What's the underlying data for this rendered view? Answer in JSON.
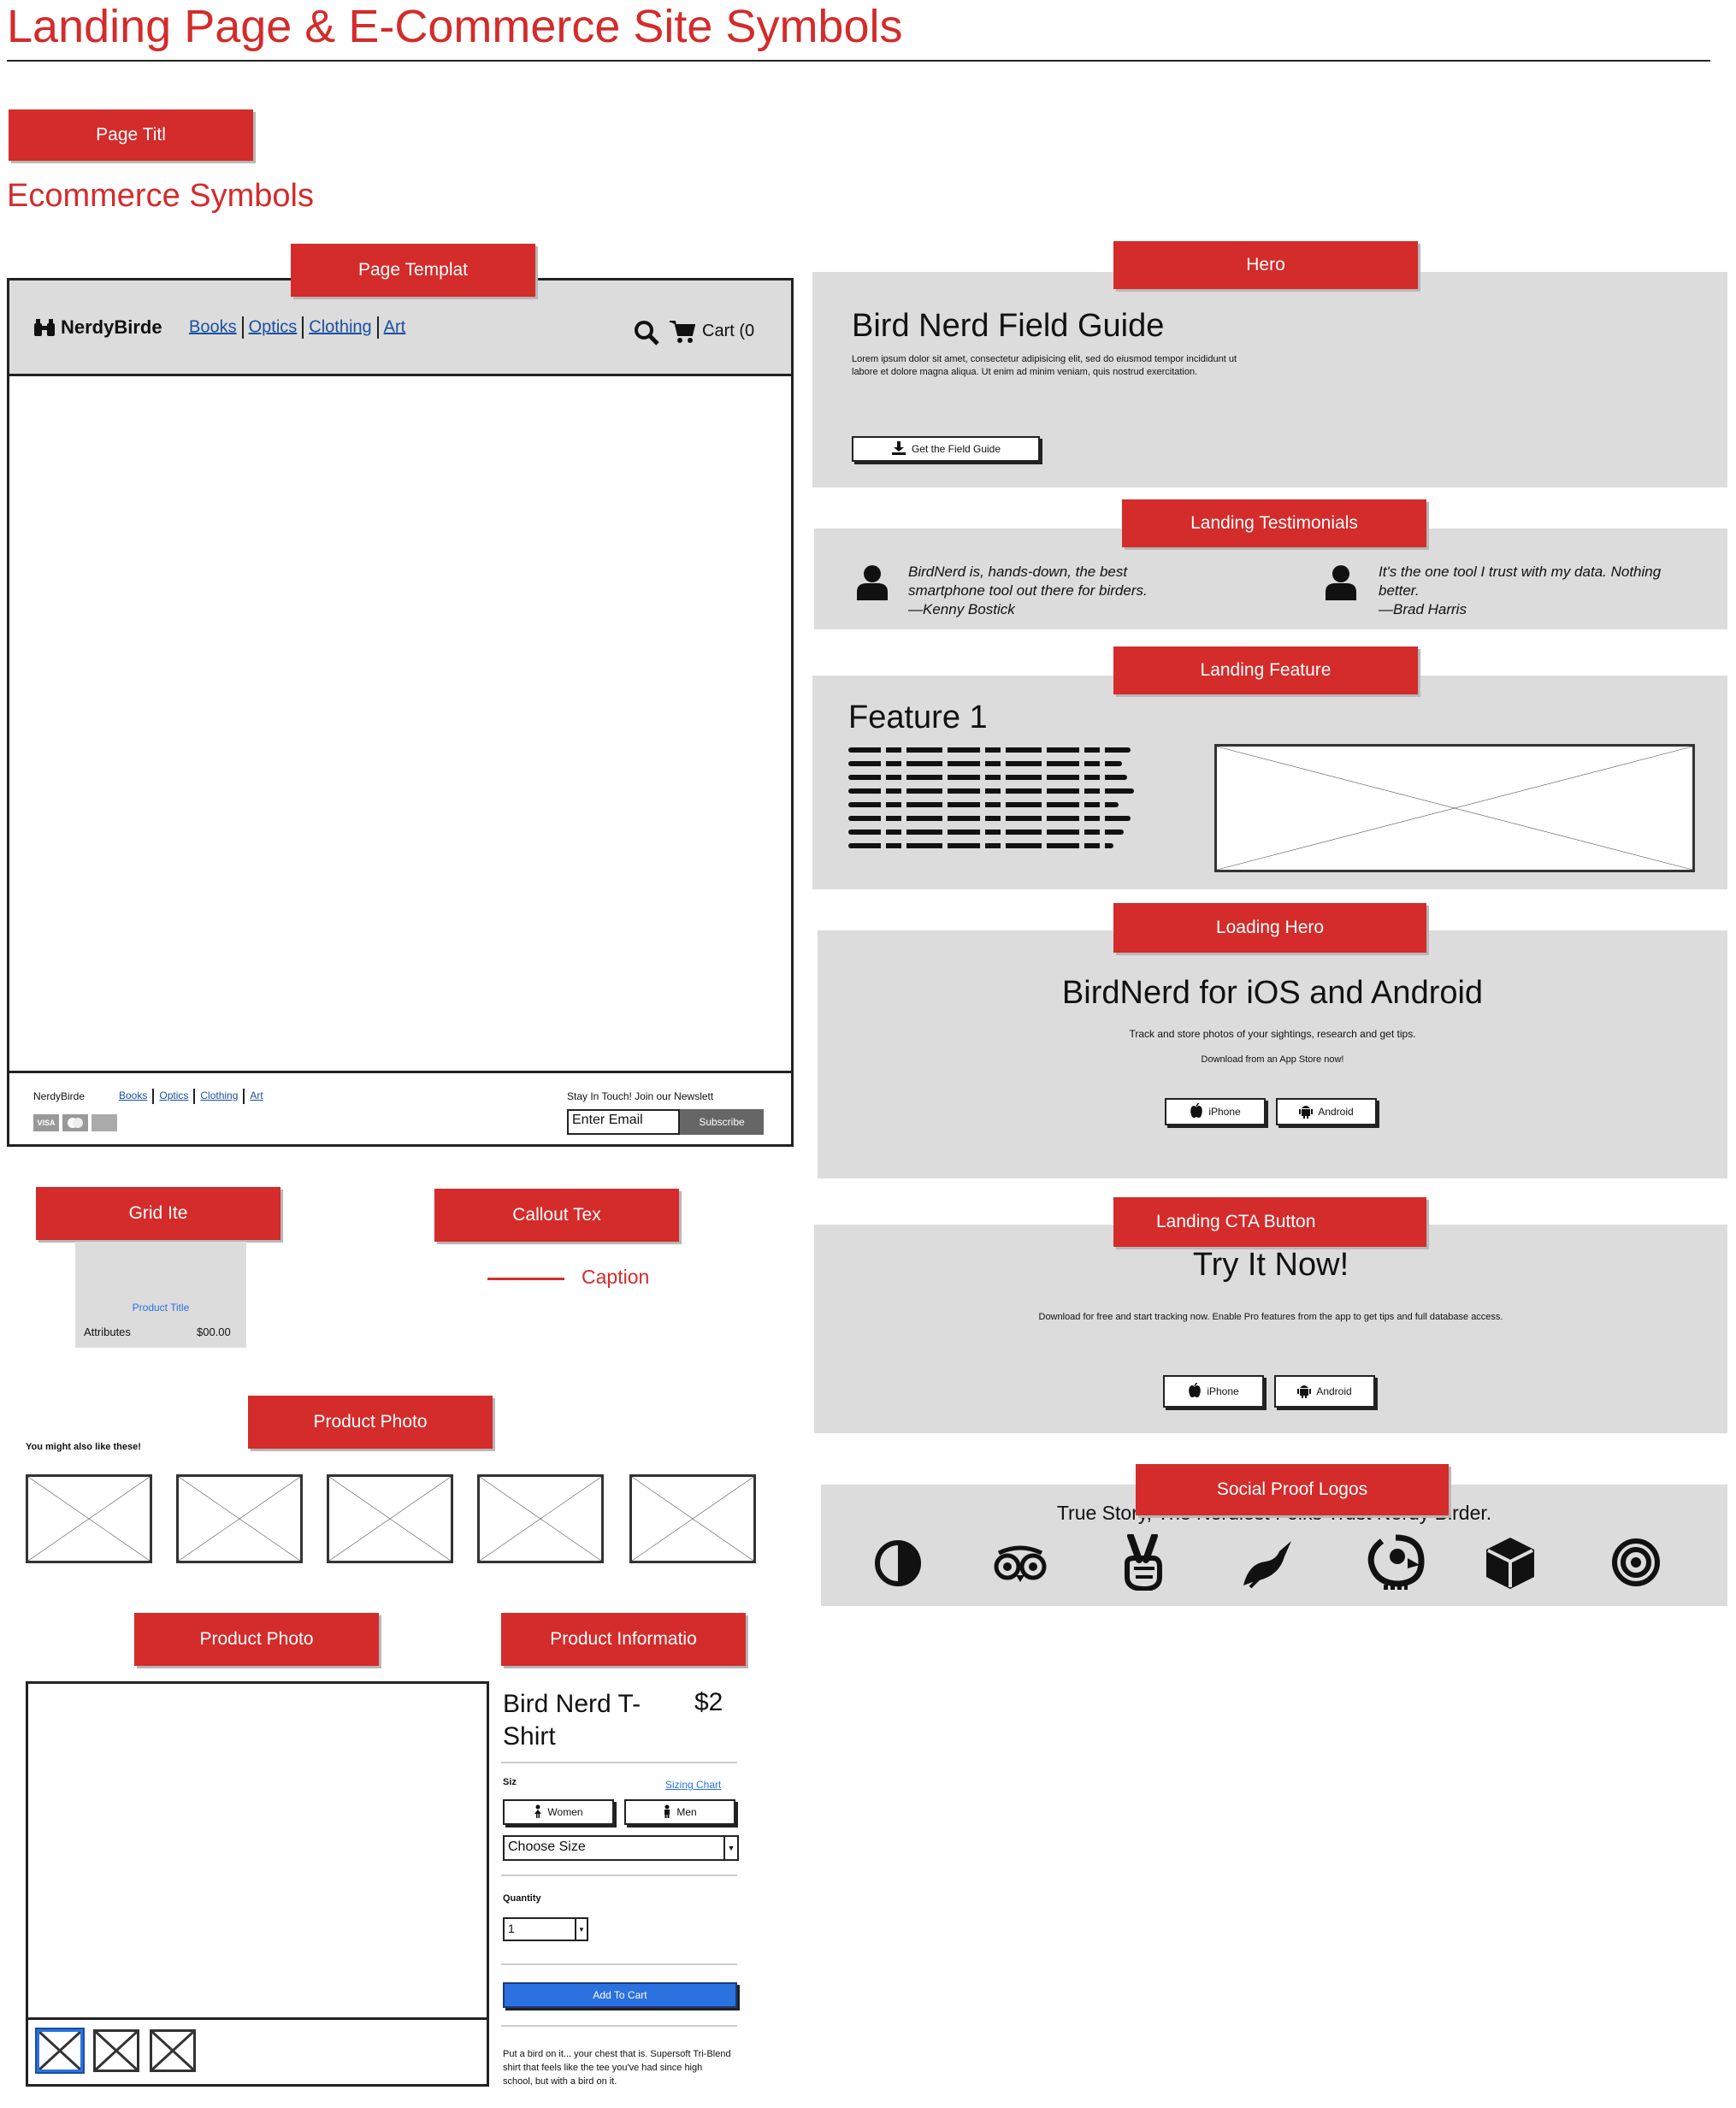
{
  "title": "Landing Page & E-Commerce Site Symbols",
  "labels": {
    "page_title": "Page Titl",
    "page_template": "Page Templat",
    "hero": "Hero",
    "landing_testimonials": "Landing Testimonials",
    "landing_feature": "Landing Feature",
    "loading_hero": "Loading Hero",
    "landing_cta_button": "Landing CTA Button",
    "social_proof_logos": "Social Proof Logos",
    "grid_item": "Grid Ite",
    "callout_text": "Callout Tex",
    "product_photo_strip": "Product Photo",
    "product_photo": "Product Photo",
    "product_info": "Product Informatio"
  },
  "section_heading": "Ecommerce Symbols",
  "template": {
    "brand": "NerdyBirde",
    "nav": [
      "Books",
      "Optics",
      "Clothing",
      "Art"
    ],
    "cart": "Cart (0",
    "footer": {
      "brand": "NerdyBirde",
      "nav": [
        "Books",
        "Optics",
        "Clothing",
        "Art"
      ],
      "newsletter_label": "Stay In Touch! Join our Newslett",
      "email_placeholder": "Enter Email",
      "subscribe": "Subscribe",
      "payment_icons": [
        "visa-icon",
        "mastercard-icon",
        "amex-icon"
      ]
    }
  },
  "hero": {
    "title": "Bird Nerd Field Guide",
    "body": "Lorem ipsum dolor sit amet, consectetur adipisicing elit, sed do eiusmod tempor incididunt ut labore et dolore magna aliqua. Ut enim ad minim veniam, quis nostrud exercitation.",
    "button": "Get the Field Guide"
  },
  "testimonials": [
    {
      "quote": "BirdNerd is, hands-down, the best smartphone tool out there for birders.",
      "author": "—Kenny Bostick"
    },
    {
      "quote": "It's the one tool I trust with my data. Nothing better.",
      "author": "—Brad Harris"
    }
  ],
  "feature": {
    "title": "Feature 1"
  },
  "loading_hero": {
    "title": "BirdNerd for iOS and Android",
    "subtitle": "Track and store photos of your sightings, research and get tips.",
    "cta": "Download from an App Store now!",
    "iphone": "iPhone",
    "android": "Android"
  },
  "cta": {
    "title": "Try It Now!",
    "body": "Download for free and start tracking now. Enable Pro features from the app to get tips and full database access.",
    "iphone": "iPhone",
    "android": "Android"
  },
  "social_proof": {
    "text": "True Story, The Nerdiest Folks Trust Nerdy Birder.",
    "logos": [
      "half-circle-icon",
      "tripadvisor-owl-icon",
      "peace-hand-icon",
      "bird-leaf-icon",
      "parrot-icon",
      "cube-icon",
      "target-icon"
    ]
  },
  "grid_item": {
    "title": "Product Title",
    "attributes": "Attributes",
    "price": "$00.00"
  },
  "callout": {
    "caption": "Caption"
  },
  "strip": {
    "heading": "You might also like these!"
  },
  "product": {
    "name": "Bird Nerd T-Shirt",
    "price": "$2",
    "size_label": "Siz",
    "sizing_chart": "Sizing Chart",
    "women": "Women",
    "men": "Men",
    "choose_size": "Choose Size",
    "quantity_label": "Quantity",
    "quantity": "1",
    "add_to_cart": "Add To Cart",
    "description": "Put a bird on it... your chest that is. Supersoft Tri-Blend shirt that feels like the tee you've had since high school, but with a bird on it."
  },
  "colors": {
    "accent": "#d42b2b",
    "panel": "#dcdcdc",
    "primary_button": "#2b72e0",
    "link": "#1a4fa0"
  }
}
